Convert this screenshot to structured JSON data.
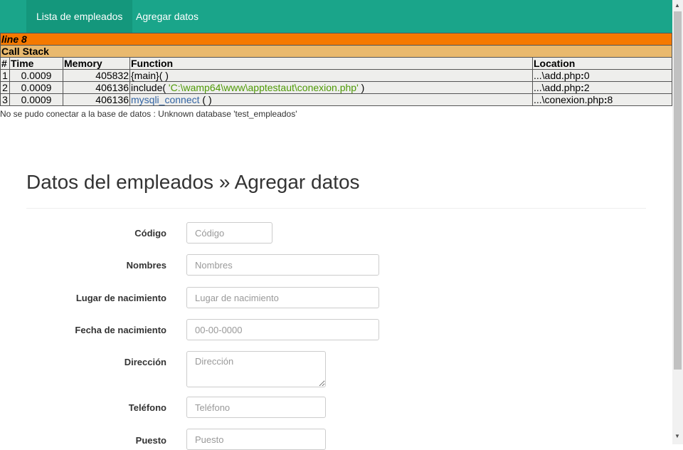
{
  "nav": {
    "items": [
      {
        "label": "Lista de empleados",
        "active": true
      },
      {
        "label": "Agregar datos",
        "active": false
      }
    ]
  },
  "xdebug": {
    "line": "line 8",
    "callstack_title": "Call Stack",
    "headers": [
      "#",
      "Time",
      "Memory",
      "Function",
      "Location"
    ],
    "rows": [
      {
        "n": "1",
        "time": "0.0009",
        "memory": "405832",
        "func": "{main}( )",
        "loc_pre": "...\\add.php",
        "loc_line": "0"
      },
      {
        "n": "2",
        "time": "0.0009",
        "memory": "406136",
        "func_pre": "include( ",
        "func_str": "'C:\\wamp64\\www\\apptestaut\\conexion.php'",
        "func_post": " )",
        "loc_pre": "...\\add.php",
        "loc_line": "2"
      },
      {
        "n": "3",
        "time": "0.0009",
        "memory": "406136",
        "func_name": "mysqli_connect",
        "func_post": " ( )",
        "loc_pre": "...\\conexion.php",
        "loc_line": "8"
      }
    ],
    "error_message": "No se pudo conectar a la base de datos : Unknown database 'test_empleados'"
  },
  "page": {
    "title": "Datos del empleados » Agregar datos"
  },
  "form": {
    "codigo": {
      "label": "Código",
      "placeholder": "Código"
    },
    "nombres": {
      "label": "Nombres",
      "placeholder": "Nombres"
    },
    "lugar": {
      "label": "Lugar de nacimiento",
      "placeholder": "Lugar de nacimiento"
    },
    "fecha": {
      "label": "Fecha de nacimiento",
      "placeholder": "00-00-0000"
    },
    "direccion": {
      "label": "Dirección",
      "placeholder": "Dirección"
    },
    "telefono": {
      "label": "Teléfono",
      "placeholder": "Teléfono"
    },
    "puesto": {
      "label": "Puesto",
      "placeholder": "Puesto"
    }
  },
  "colors": {
    "navbar": "#1aa58a",
    "xdebug_line": "#f57900",
    "xdebug_callstack": "#e9b96e"
  }
}
